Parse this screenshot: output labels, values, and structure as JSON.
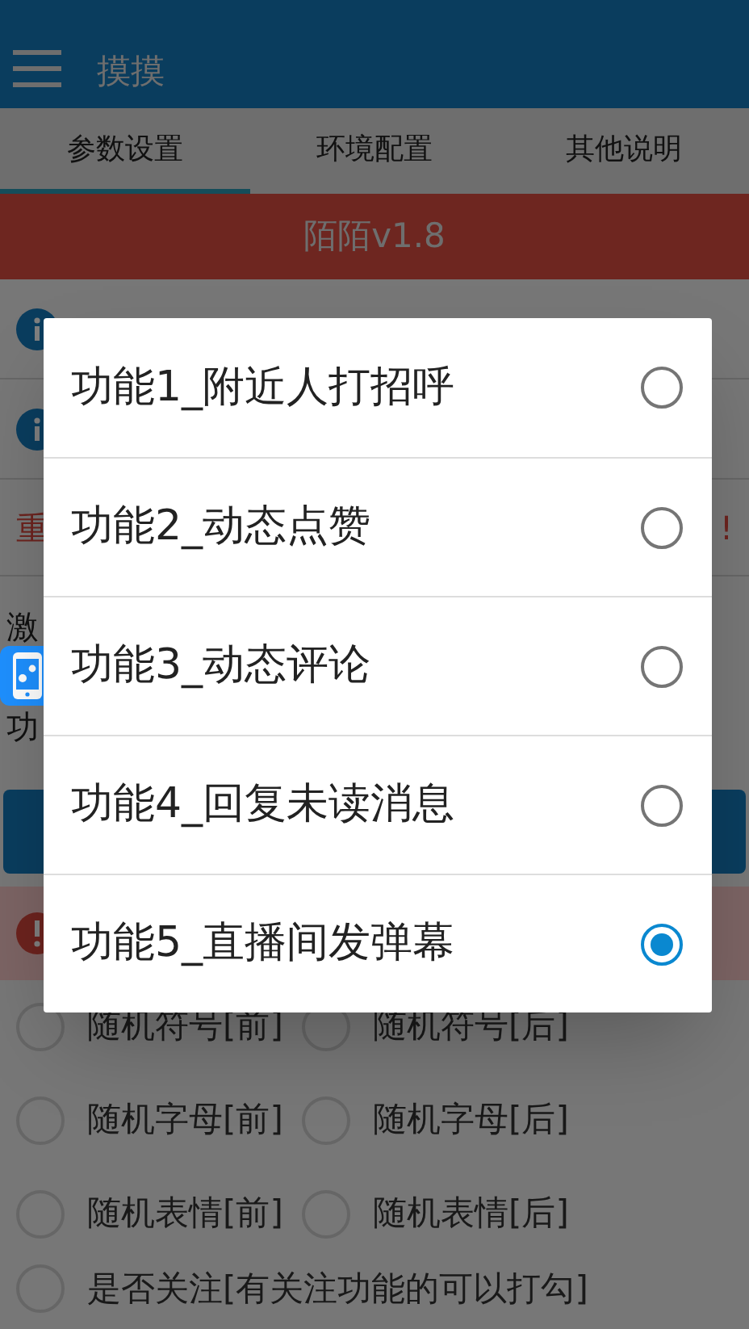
{
  "app_bar": {
    "title": "摸摸"
  },
  "tabs": [
    {
      "label": "参数设置",
      "selected": true
    },
    {
      "label": "环境配置",
      "selected": false
    },
    {
      "label": "其他说明",
      "selected": false
    }
  ],
  "banner": {
    "title": "陌陌v1.8"
  },
  "blocks": [
    {
      "kind": "info"
    },
    {
      "kind": "info"
    },
    {
      "kind": "notice",
      "text": "重",
      "end": "!"
    },
    {
      "kind": "label",
      "text": "激"
    },
    {
      "kind": "label",
      "text": "功"
    },
    {
      "kind": "button"
    },
    {
      "kind": "warning"
    }
  ],
  "options": [
    {
      "label": "随机符号[前]",
      "checked": false
    },
    {
      "label": "随机符号[后]",
      "checked": false
    },
    {
      "label": "随机字母[前]",
      "checked": false
    },
    {
      "label": "随机字母[后]",
      "checked": false
    },
    {
      "label": "随机表情[前]",
      "checked": false
    },
    {
      "label": "随机表情[后]",
      "checked": false
    }
  ],
  "last_option": {
    "label": "是否关注[有关注功能的可以打勾]",
    "checked": false
  },
  "dialog": {
    "items": [
      {
        "label": "功能1_附近人打招呼",
        "selected": false
      },
      {
        "label": "功能2_动态点赞",
        "selected": false
      },
      {
        "label": "功能3_动态评论",
        "selected": false
      },
      {
        "label": "功能4_回复未读消息",
        "selected": false
      },
      {
        "label": "功能5_直播间发弹幕",
        "selected": true
      }
    ]
  }
}
